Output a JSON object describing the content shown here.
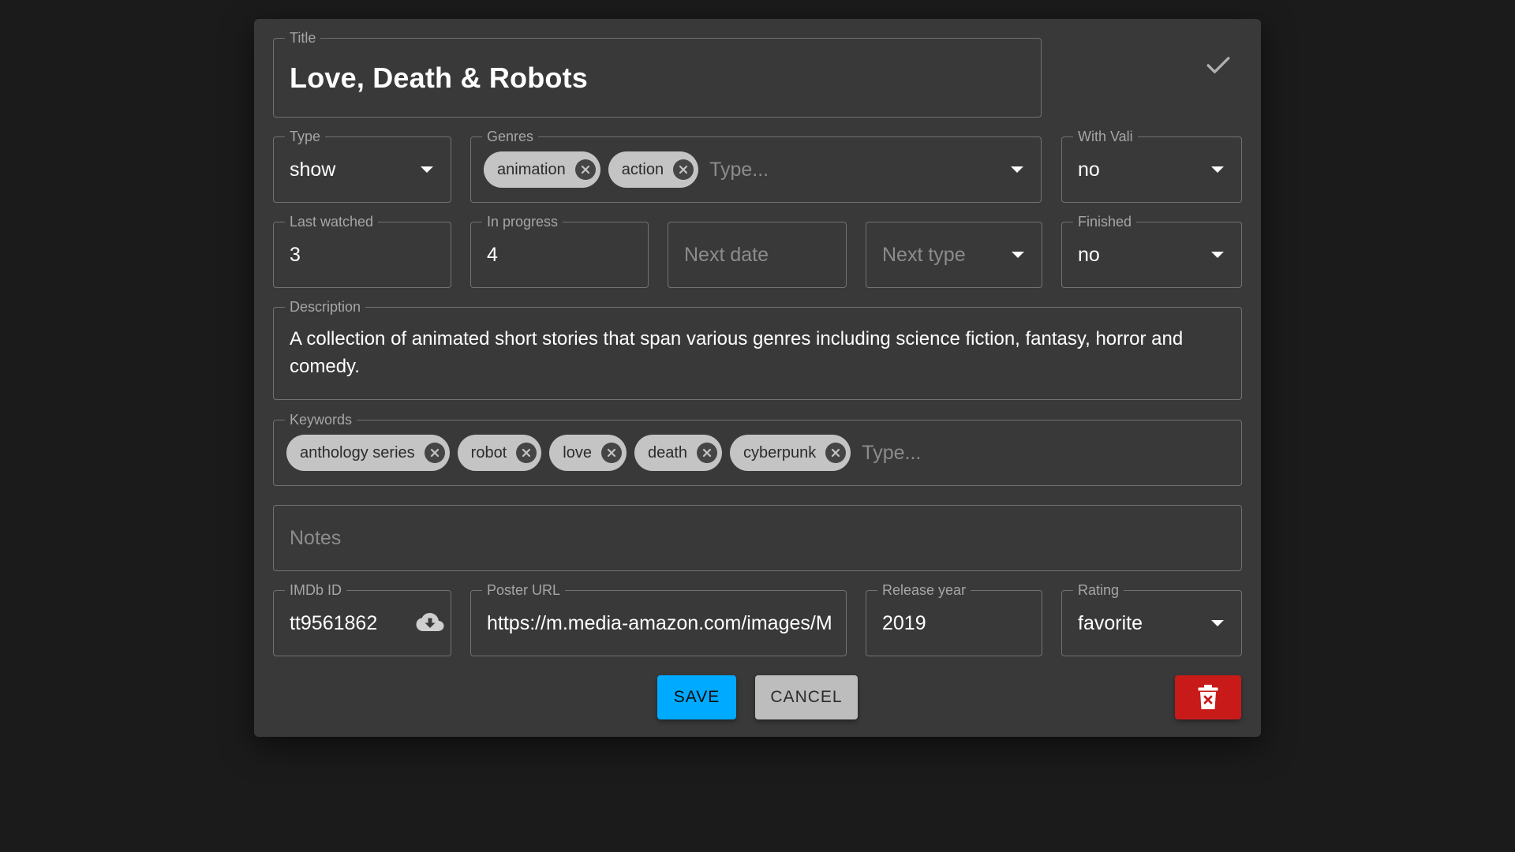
{
  "title_field": {
    "label": "Title",
    "value": "Love, Death & Robots"
  },
  "type_field": {
    "label": "Type",
    "value": "show"
  },
  "genres_field": {
    "label": "Genres",
    "chips": [
      "animation",
      "action"
    ],
    "placeholder": "Type..."
  },
  "with_vali_field": {
    "label": "With Vali",
    "value": "no"
  },
  "last_watched_field": {
    "label": "Last watched",
    "value": "3"
  },
  "in_progress_field": {
    "label": "In progress",
    "value": "4"
  },
  "next_date_field": {
    "placeholder": "Next date"
  },
  "next_type_field": {
    "placeholder": "Next type"
  },
  "finished_field": {
    "label": "Finished",
    "value": "no"
  },
  "description_field": {
    "label": "Description",
    "value": "A collection of animated short stories that span various genres including science fiction, fantasy, horror and comedy."
  },
  "keywords_field": {
    "label": "Keywords",
    "chips": [
      "anthology series",
      "robot",
      "love",
      "death",
      "cyberpunk"
    ],
    "placeholder": "Type..."
  },
  "notes_field": {
    "placeholder": "Notes"
  },
  "imdb_field": {
    "label": "IMDb ID",
    "value": "tt9561862"
  },
  "poster_field": {
    "label": "Poster URL",
    "value": "https://m.media-amazon.com/images/M"
  },
  "release_year_field": {
    "label": "Release year",
    "value": "2019"
  },
  "rating_field": {
    "label": "Rating",
    "value": "favorite"
  },
  "buttons": {
    "save": "SAVE",
    "cancel": "CANCEL"
  },
  "icons": {
    "confirm": "check-icon",
    "fetch": "cloud-download-icon",
    "delete": "trash-icon",
    "chip_remove": "close-circle-icon",
    "dropdown": "caret-down-icon"
  },
  "colors": {
    "background": "#1b1b1b",
    "dialog": "#393939",
    "save": "#00aaff",
    "cancel": "#bdbdbd",
    "delete": "#c91a1a",
    "chip": "#c4c4c4"
  }
}
